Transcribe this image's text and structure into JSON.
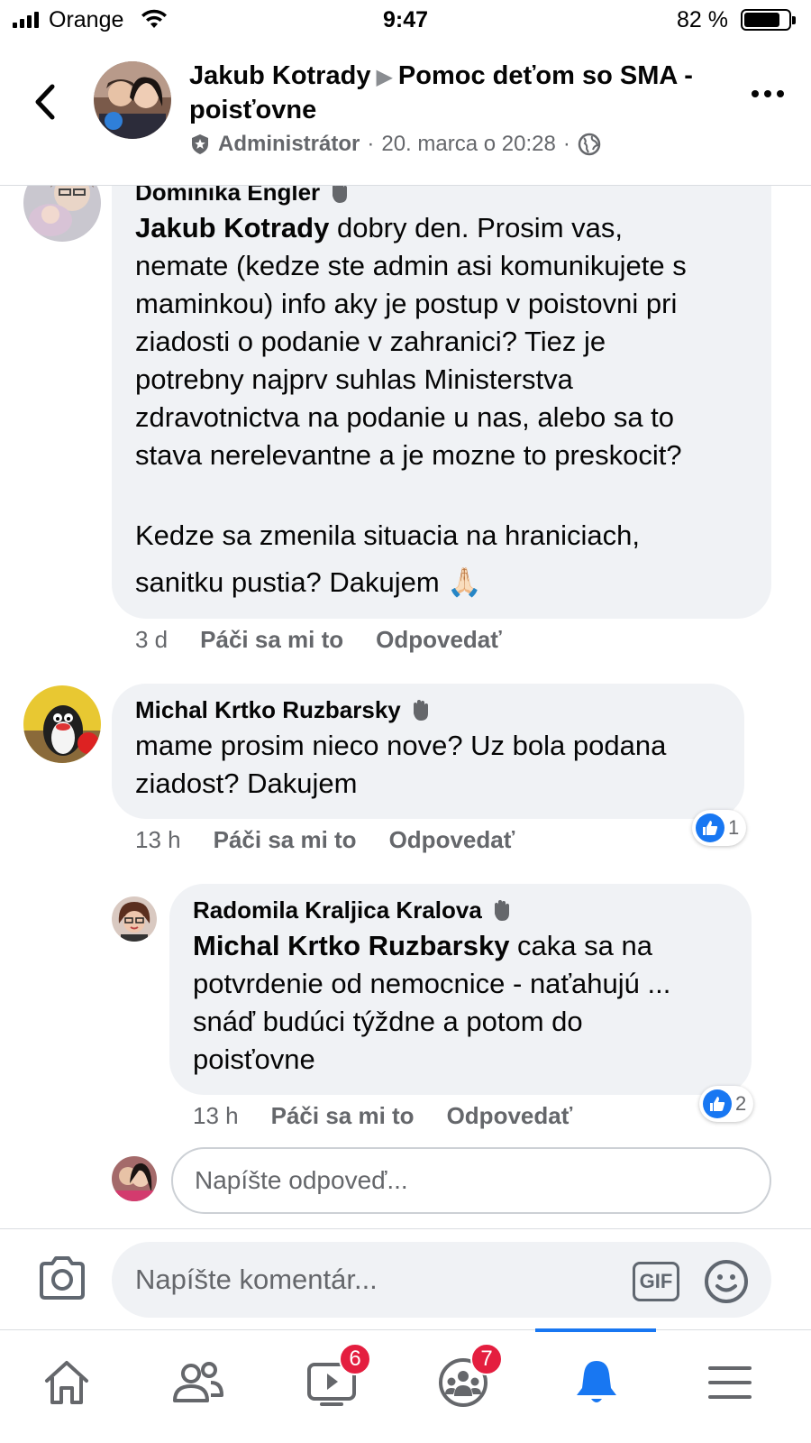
{
  "status_bar": {
    "carrier": "Orange",
    "time": "9:47",
    "battery_text": "82 %",
    "battery_level": 0.82
  },
  "header": {
    "author": "Jakub Kotrady",
    "group": "Pomoc deťom so SMA - poisťovne",
    "role": "Administrátor",
    "separator": "·",
    "date": "20. marca o 20:28",
    "back_icon": "chevron-left-icon",
    "more_icon": "more-dots-icon"
  },
  "comments": [
    {
      "author": "Dominika Engler",
      "mention": "Jakub Kotrady",
      "text_lines": [
        " dobry den. Prosim vas,",
        "nemate (kedze ste admin asi komunikujete s",
        "maminkou) info aky je postup v poistovni pri",
        "ziadosti o podanie v zahranici? Tiez je",
        "potrebny najprv suhlas Ministerstva",
        "zdravotnictva na podanie u nas, alebo sa to",
        "stava nerelevantne a je mozne to preskocit?"
      ],
      "text_lines_2": [
        "Kedze sa zmenila situacia na hraniciach,",
        "sanitku pustia? Dakujem"
      ],
      "emoji": "🙏🏻",
      "time": "3 d",
      "like_label": "Páči sa mi to",
      "reply_label": "Odpovedať"
    },
    {
      "author": "Michal Krtko Ruzbarsky",
      "text_lines": [
        "mame prosim nieco nove? Uz bola podana",
        "ziadost? Dakujem"
      ],
      "time": "13 h",
      "like_label": "Páči sa mi to",
      "reply_label": "Odpovedať",
      "reaction_count": "1"
    },
    {
      "author": "Radomila Kraljica Kralova",
      "mention": "Michal Krtko Ruzbarsky",
      "text_lines": [
        " caka sa na",
        "potvrdenie od nemocnice - naťahujú ...",
        "snáď budúci týždne a potom do",
        "poisťovne"
      ],
      "time": "13 h",
      "like_label": "Páči sa mi to",
      "reply_label": "Odpovedať",
      "reaction_count": "2"
    }
  ],
  "reply_placeholder": "Napíšte odpoveď...",
  "composer": {
    "placeholder": "Napíšte komentár...",
    "gif_label": "GIF"
  },
  "tabbar": {
    "tabs": [
      {
        "icon": "home-icon"
      },
      {
        "icon": "friends-icon"
      },
      {
        "icon": "watch-icon",
        "badge": "6"
      },
      {
        "icon": "groups-icon",
        "badge": "7"
      },
      {
        "icon": "bell-icon",
        "active": true
      },
      {
        "icon": "menu-icon"
      }
    ]
  },
  "colors": {
    "accent": "#1877f2",
    "badge": "#e41e3f",
    "bubble": "#f0f2f5",
    "secondary_text": "#65676b"
  }
}
